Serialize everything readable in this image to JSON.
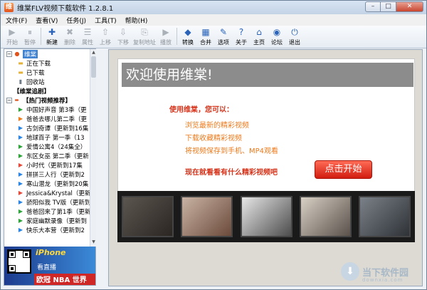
{
  "window": {
    "title": "维棠FLV视频下载软件 1.2.8.1",
    "min": "–",
    "max": "□",
    "close": "✕"
  },
  "menu": [
    "文件(F)",
    "查看(V)",
    "任务(J)",
    "工具(T)",
    "帮助(H)"
  ],
  "toolbar": [
    {
      "label": "开始",
      "icon": "play-icon",
      "glyph": "▶",
      "off": true
    },
    {
      "label": "暂停",
      "icon": "pause-icon",
      "glyph": "⏸",
      "off": true
    },
    {
      "label": "新建",
      "icon": "new-icon",
      "glyph": "✚",
      "off": false
    },
    {
      "label": "删除",
      "icon": "delete-icon",
      "glyph": "✖",
      "off": true
    },
    {
      "label": "属性",
      "icon": "properties-icon",
      "glyph": "☰",
      "off": true
    },
    {
      "label": "上移",
      "icon": "up-icon",
      "glyph": "⇧",
      "off": true
    },
    {
      "label": "下移",
      "icon": "down-icon",
      "glyph": "⇩",
      "off": true
    },
    {
      "label": "复制地址",
      "icon": "copy-icon",
      "glyph": "⎘",
      "off": true,
      "wide": true
    },
    {
      "label": "播放",
      "icon": "play-media-icon",
      "glyph": "▶",
      "off": true
    },
    {
      "label": "转换",
      "icon": "convert-icon",
      "glyph": "◆",
      "off": false
    },
    {
      "label": "合并",
      "icon": "merge-icon",
      "glyph": "▦",
      "off": false
    },
    {
      "label": "选项",
      "icon": "options-icon",
      "glyph": "✎",
      "off": false
    },
    {
      "label": "关于",
      "icon": "about-icon",
      "glyph": "?",
      "off": false
    },
    {
      "label": "主页",
      "icon": "home-icon",
      "glyph": "⌂",
      "off": false
    },
    {
      "label": "论坛",
      "icon": "forum-icon",
      "glyph": "◉",
      "off": false
    },
    {
      "label": "退出",
      "icon": "exit-icon",
      "glyph": "⏻",
      "off": false
    }
  ],
  "tree": [
    {
      "text": "维棠",
      "level": 0,
      "exp": "−",
      "icon": "app-icon",
      "glyph": "●",
      "color": "#e2531c",
      "sel": true
    },
    {
      "text": "正在下载",
      "level": 1,
      "icon": "folder-icon",
      "glyph": "▬",
      "color": "#e2b23a"
    },
    {
      "text": "已下载",
      "level": 1,
      "icon": "folder-icon",
      "glyph": "▬",
      "color": "#e2b23a"
    },
    {
      "text": "回收站",
      "level": 1,
      "icon": "recycle-icon",
      "glyph": "▮",
      "color": "#6e7b88"
    },
    {
      "text": "【维棠追剧】",
      "level": 0,
      "exp": "",
      "icon": "none",
      "glyph": "",
      "color": "#000"
    },
    {
      "text": "【热门视频推荐】",
      "level": 0,
      "exp": "−",
      "icon": "arrow-icon",
      "glyph": "➨",
      "color": "#e2531c"
    },
    {
      "text": "中国好声音 第3季（更",
      "level": 1,
      "icon": "iqiyi-icon",
      "glyph": "▶",
      "color": "#2ea43a"
    },
    {
      "text": "爸爸去哪儿第二季（更",
      "level": 1,
      "icon": "mgtv-icon",
      "glyph": "▶",
      "color": "#f07c1a"
    },
    {
      "text": "古剑奇谭（更新到16集",
      "level": 1,
      "icon": "youku-icon",
      "glyph": "▶",
      "color": "#2b85e4"
    },
    {
      "text": "地球百子 第一季（13",
      "level": 1,
      "icon": "youku-icon",
      "glyph": "▶",
      "color": "#2b85e4"
    },
    {
      "text": "爱情公寓4（24集全）",
      "level": 1,
      "icon": "iqiyi-icon",
      "glyph": "▶",
      "color": "#2ea43a"
    },
    {
      "text": "东区女巫 第二季（更新",
      "level": 1,
      "icon": "iqiyi-icon",
      "glyph": "▶",
      "color": "#2ea43a"
    },
    {
      "text": "小时代（更新到17集",
      "level": 1,
      "icon": "tv-icon",
      "glyph": "▶",
      "color": "#e64a3b"
    },
    {
      "text": "拼拼三人行（更新到2",
      "level": 1,
      "icon": "youku-icon",
      "glyph": "▶",
      "color": "#2b85e4"
    },
    {
      "text": "寒山潜龙（更新到20集",
      "level": 1,
      "icon": "youku-icon",
      "glyph": "▶",
      "color": "#2b85e4"
    },
    {
      "text": "Jessica&Krystal（更新",
      "level": 1,
      "icon": "tv-icon",
      "glyph": "▶",
      "color": "#e64a3b"
    },
    {
      "text": "骄阳似我 TV版（更新到",
      "level": 1,
      "icon": "youku-icon",
      "glyph": "▶",
      "color": "#2b85e4"
    },
    {
      "text": "爸爸回来了第1季（更新",
      "level": 1,
      "icon": "iqiyi-icon",
      "glyph": "▶",
      "color": "#2ea43a"
    },
    {
      "text": "家庭幽默录像（更新到",
      "level": 1,
      "icon": "iqiyi-icon",
      "glyph": "▶",
      "color": "#2ea43a"
    },
    {
      "text": "快乐大本营（更新到2",
      "level": 1,
      "icon": "youku-icon",
      "glyph": "▶",
      "color": "#2b85e4"
    }
  ],
  "ad": {
    "line1": "iPhone",
    "line2": "看直播",
    "line3": "欧冠 NBA 世界杯"
  },
  "main": {
    "welcome": "欢迎使用维棠!",
    "greeting": "使用维棠，您可以：",
    "features": [
      "浏览最新的精彩视频",
      "下载收藏精彩视频",
      "将视频保存到手机、MP4观看"
    ],
    "ask": "现在就看看有什么精彩视频吧",
    "start": "点击开始"
  },
  "watermark": {
    "name": "当下软件园",
    "url": "downxia.com"
  }
}
